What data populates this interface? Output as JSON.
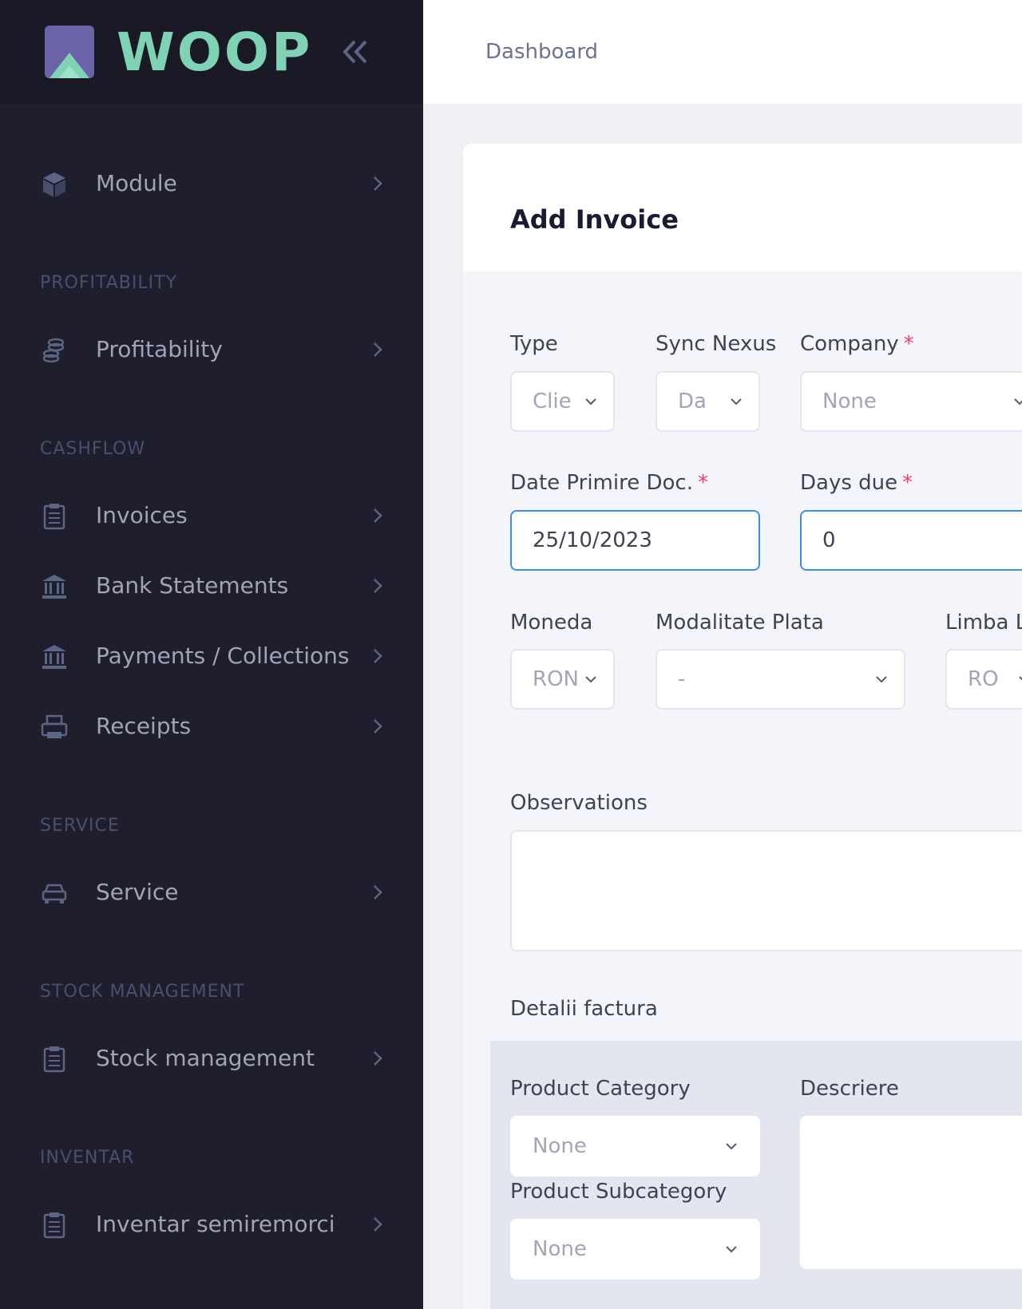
{
  "app": {
    "name": "WOOP"
  },
  "topbar": {
    "breadcrumb": "Dashboard"
  },
  "sidebar": {
    "items": [
      {
        "label": "Module",
        "icon": "cube-icon"
      },
      {
        "label": "Profitability",
        "icon": "coins-icon"
      },
      {
        "label": "Invoices",
        "icon": "clipboard-list-icon"
      },
      {
        "label": "Bank Statements",
        "icon": "bank-icon"
      },
      {
        "label": "Payments / Collections",
        "icon": "bank-icon"
      },
      {
        "label": "Receipts",
        "icon": "printer-icon"
      },
      {
        "label": "Service",
        "icon": "car-icon"
      },
      {
        "label": "Stock management",
        "icon": "clipboard-list-icon"
      },
      {
        "label": "Inventar semiremorci",
        "icon": "clipboard-list-icon"
      }
    ],
    "sections": [
      "PROFITABILITY",
      "CASHFLOW",
      "SERVICE",
      "STOCK MANAGEMENT",
      "INVENTAR"
    ]
  },
  "form": {
    "title": "Add Invoice",
    "type": {
      "label": "Type",
      "value": "Clie"
    },
    "sync_nexus": {
      "label": "Sync Nexus",
      "value": "Da"
    },
    "company": {
      "label": "Company",
      "required": "*",
      "value": "None"
    },
    "date_primire": {
      "label": "Date Primire Doc.",
      "required": "*",
      "value": "25/10/2023"
    },
    "days_due": {
      "label": "Days due",
      "required": "*",
      "value": "0"
    },
    "moneda": {
      "label": "Moneda",
      "value": "RON"
    },
    "modalitate_plata": {
      "label": "Modalitate Plata",
      "value": "-"
    },
    "limba": {
      "label": "Limba L",
      "value": "RO"
    },
    "observations": {
      "label": "Observations"
    },
    "details_heading": "Detalii factura",
    "product_category": {
      "label": "Product Category",
      "value": "None"
    },
    "product_subcategory": {
      "label": "Product Subcategory",
      "value": "None"
    },
    "descriere": {
      "label": "Descriere"
    }
  },
  "colors": {
    "sidebar_bg": "#1e1e2d",
    "accent": "#3e8bf0",
    "logo": "#7fd3b4",
    "required": "#f1416c"
  }
}
